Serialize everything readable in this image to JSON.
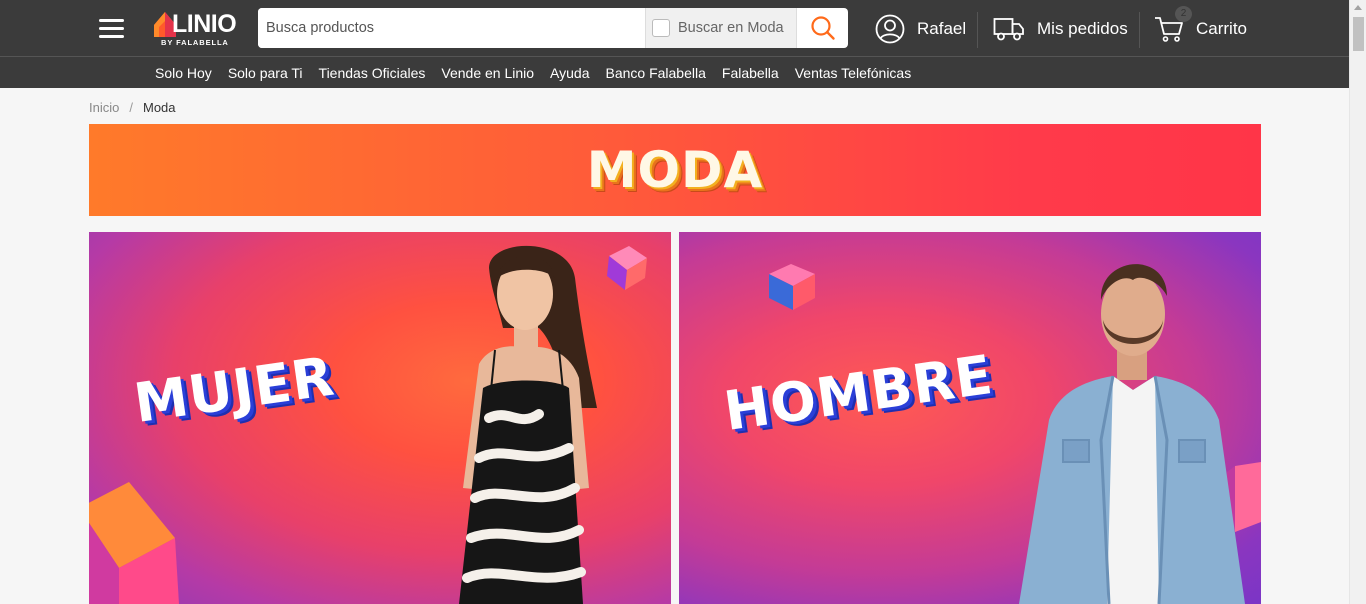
{
  "header": {
    "logo_word": "LINIO",
    "logo_sub": "BY FALABELLA",
    "search_placeholder": "Busca productos",
    "search_scope_label": "Buscar en Moda",
    "user_name": "Rafael",
    "orders_label": "Mis pedidos",
    "cart_label": "Carrito",
    "cart_count": "2"
  },
  "subnav": {
    "items": [
      "Solo Hoy",
      "Solo para Ti",
      "Tiendas Oficiales",
      "Vende en Linio",
      "Ayuda",
      "Banco Falabella",
      "Falabella",
      "Ventas Telefónicas"
    ]
  },
  "breadcrumb": {
    "home": "Inicio",
    "separator": "/",
    "current": "Moda"
  },
  "banner": {
    "title": "MODA"
  },
  "categories": [
    {
      "label": "MUJER"
    },
    {
      "label": "HOMBRE"
    }
  ],
  "colors": {
    "header_bg": "#3b3b3b",
    "accent_orange": "#ff6a2a",
    "banner_red": "#ff3548",
    "label_shadow_blue": "#2a3fd8"
  },
  "icons": {
    "menu": "hamburger-icon",
    "search": "search-icon",
    "user": "user-circle-icon",
    "orders": "truck-icon",
    "cart": "cart-icon"
  }
}
